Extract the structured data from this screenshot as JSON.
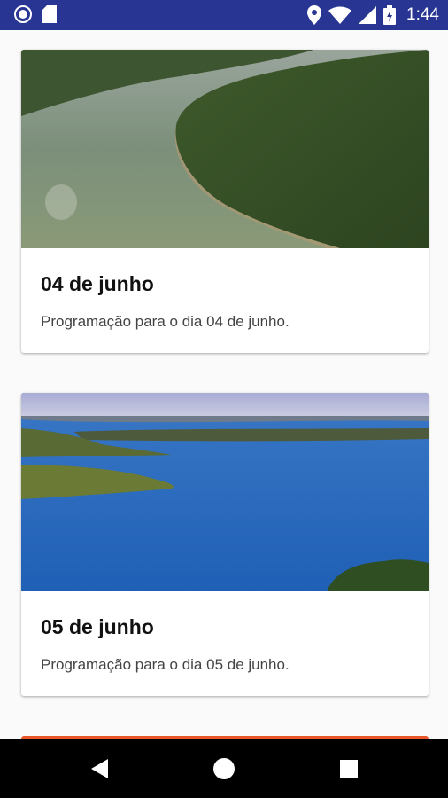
{
  "status_bar": {
    "time": "1:44",
    "icons_left": [
      "circle-notification-icon",
      "sd-card-icon"
    ],
    "icons_right": [
      "location-icon",
      "wifi-icon",
      "signal-icon",
      "battery-charging-icon"
    ],
    "background_color": "#283593"
  },
  "cards": [
    {
      "title": "04 de junho",
      "description": "Programação para o dia 04 de junho.",
      "image": "river-forest-aerial"
    },
    {
      "title": "05 de junho",
      "description": "Programação para o dia 05 de junho.",
      "image": "blue-lake-aerial"
    }
  ],
  "next_card_accent_color": "#e8572a",
  "nav_bar": {
    "buttons": [
      "back-icon",
      "home-icon",
      "recents-icon"
    ]
  }
}
